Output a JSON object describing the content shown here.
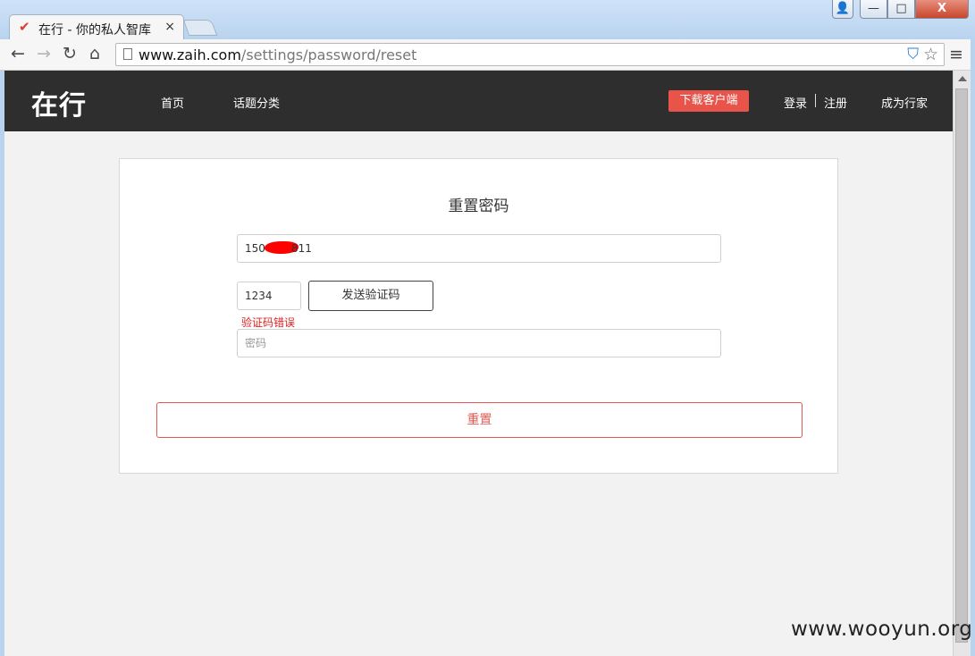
{
  "browser": {
    "tab_title": "在行 - 你的私人智库",
    "tab_close": "×",
    "url_host": "www.zaih.com",
    "url_path": "/settings/password/reset",
    "window_buttons": {
      "user": "👤",
      "minimize": "—",
      "maximize": "□",
      "close": "X"
    }
  },
  "site": {
    "logo": "在行",
    "nav": {
      "home": "首页",
      "topics": "话题分类"
    },
    "download_button": "下载客户端",
    "login": "登录",
    "register": "注册",
    "become_expert": "成为行家",
    "accent_color": "#e8534a"
  },
  "form": {
    "title": "重置密码",
    "phone_visible_prefix": "150",
    "phone_visible_suffix": "811",
    "code_value": "1234",
    "send_code_button": "发送验证码",
    "error_message": "验证码错误",
    "password_placeholder": "密码",
    "reset_button": "重置"
  },
  "watermark": "www.wooyun.org"
}
